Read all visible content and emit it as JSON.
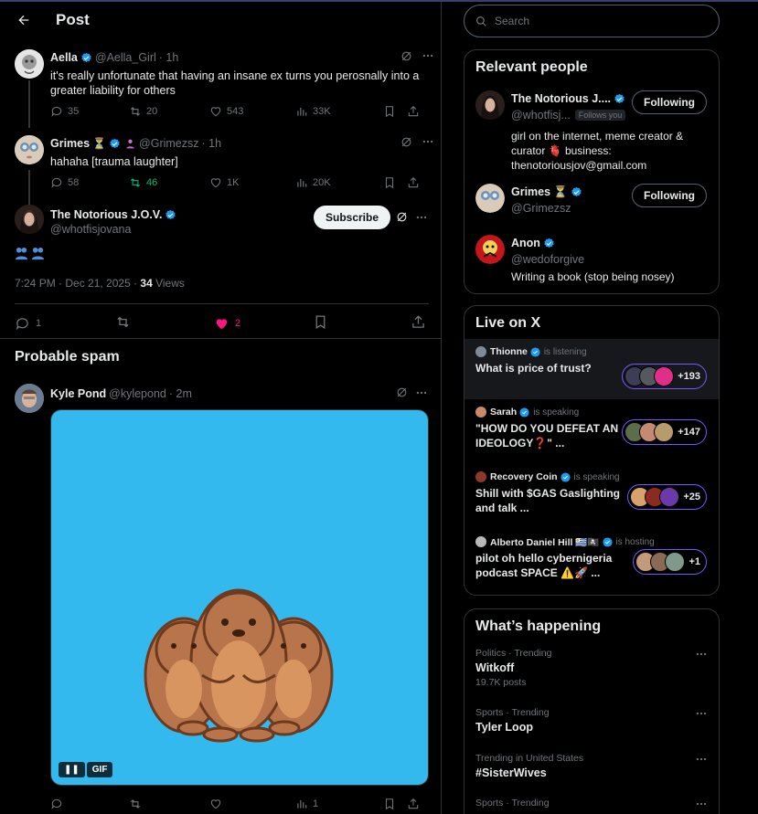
{
  "header": {
    "title": "Post"
  },
  "thread": [
    {
      "name": "Aella",
      "handle": "@Aella_Girl",
      "time": "· 1h",
      "text": "it's really unfortunate that having an insane ex turns you perosnally into a greater liability for others",
      "replies": "35",
      "reposts": "20",
      "likes": "543",
      "views": "33K"
    },
    {
      "name": "Grimes",
      "name_emoji": "⏳",
      "handle": "@Grimezsz",
      "time": "· 1h",
      "text": "hahaha [trauma laughter]",
      "replies": "58",
      "reposts": "46",
      "likes": "1K",
      "views": "20K"
    }
  ],
  "focus": {
    "name": "The Notorious J.O.V.",
    "handle": "@whotfisjovana",
    "subscribe_label": "Subscribe",
    "timestamp": "7:24 PM · Dec 21, 2025 · ",
    "views_count": "34",
    "views_label": " Views",
    "replies": "1",
    "likes": "2"
  },
  "spam": {
    "section_title": "Probable spam",
    "name": "Kyle Pond",
    "handle": "@kylepond",
    "time": "· 2m",
    "gif_label": "GIF",
    "views": "1"
  },
  "search": {
    "placeholder": "Search"
  },
  "relevant": {
    "title": "Relevant people",
    "people": [
      {
        "name": "The Notorious J....",
        "handle": "@whotfisj...",
        "follows_you": "Follows you",
        "button": "Following",
        "bio": "girl on the internet, meme creator & curator 🫀 business: thenotoriousjov@gmail.com"
      },
      {
        "name": "Grimes",
        "emoji": "⏳",
        "handle": "@Grimezsz",
        "button": "Following"
      },
      {
        "name": "Anon",
        "handle": "@wedoforgive",
        "bio": "Writing a book (stop being nosey)"
      }
    ]
  },
  "live": {
    "title": "Live on X",
    "items": [
      {
        "host": "Thionne",
        "status": "is listening",
        "title": "What is price of trust?",
        "count": "+193"
      },
      {
        "host": "Sarah",
        "status": "is speaking",
        "title": "\"HOW DO YOU DEFEAT AN IDEOLOGY❓\" ...",
        "count": "+147"
      },
      {
        "host": "Recovery Coin",
        "status": "is speaking",
        "title": "Shill with $GAS Gaslighting and talk ...",
        "count": "+25"
      },
      {
        "host": "Alberto Daniel Hill 🇺🇾🏴‍☠️",
        "status": "is hosting",
        "title": "pilot oh hello cybernigeria podcast SPACE ⚠️🚀 ...",
        "count": "+1"
      }
    ]
  },
  "happening": {
    "title": "What’s happening",
    "trends": [
      {
        "category": "Politics · Trending",
        "topic": "Witkoff",
        "posts": "19.7K posts"
      },
      {
        "category": "Sports · Trending",
        "topic": "Tyler Loop",
        "posts": ""
      },
      {
        "category": "Trending in United States",
        "topic": "#SisterWives",
        "posts": ""
      },
      {
        "category": "Sports · Trending",
        "topic": "",
        "posts": ""
      }
    ]
  },
  "colors": {
    "accent": "#1d9bf0",
    "repost_active": "#00ba7c",
    "like_active": "#f91880",
    "live_border": "#7856ff"
  }
}
